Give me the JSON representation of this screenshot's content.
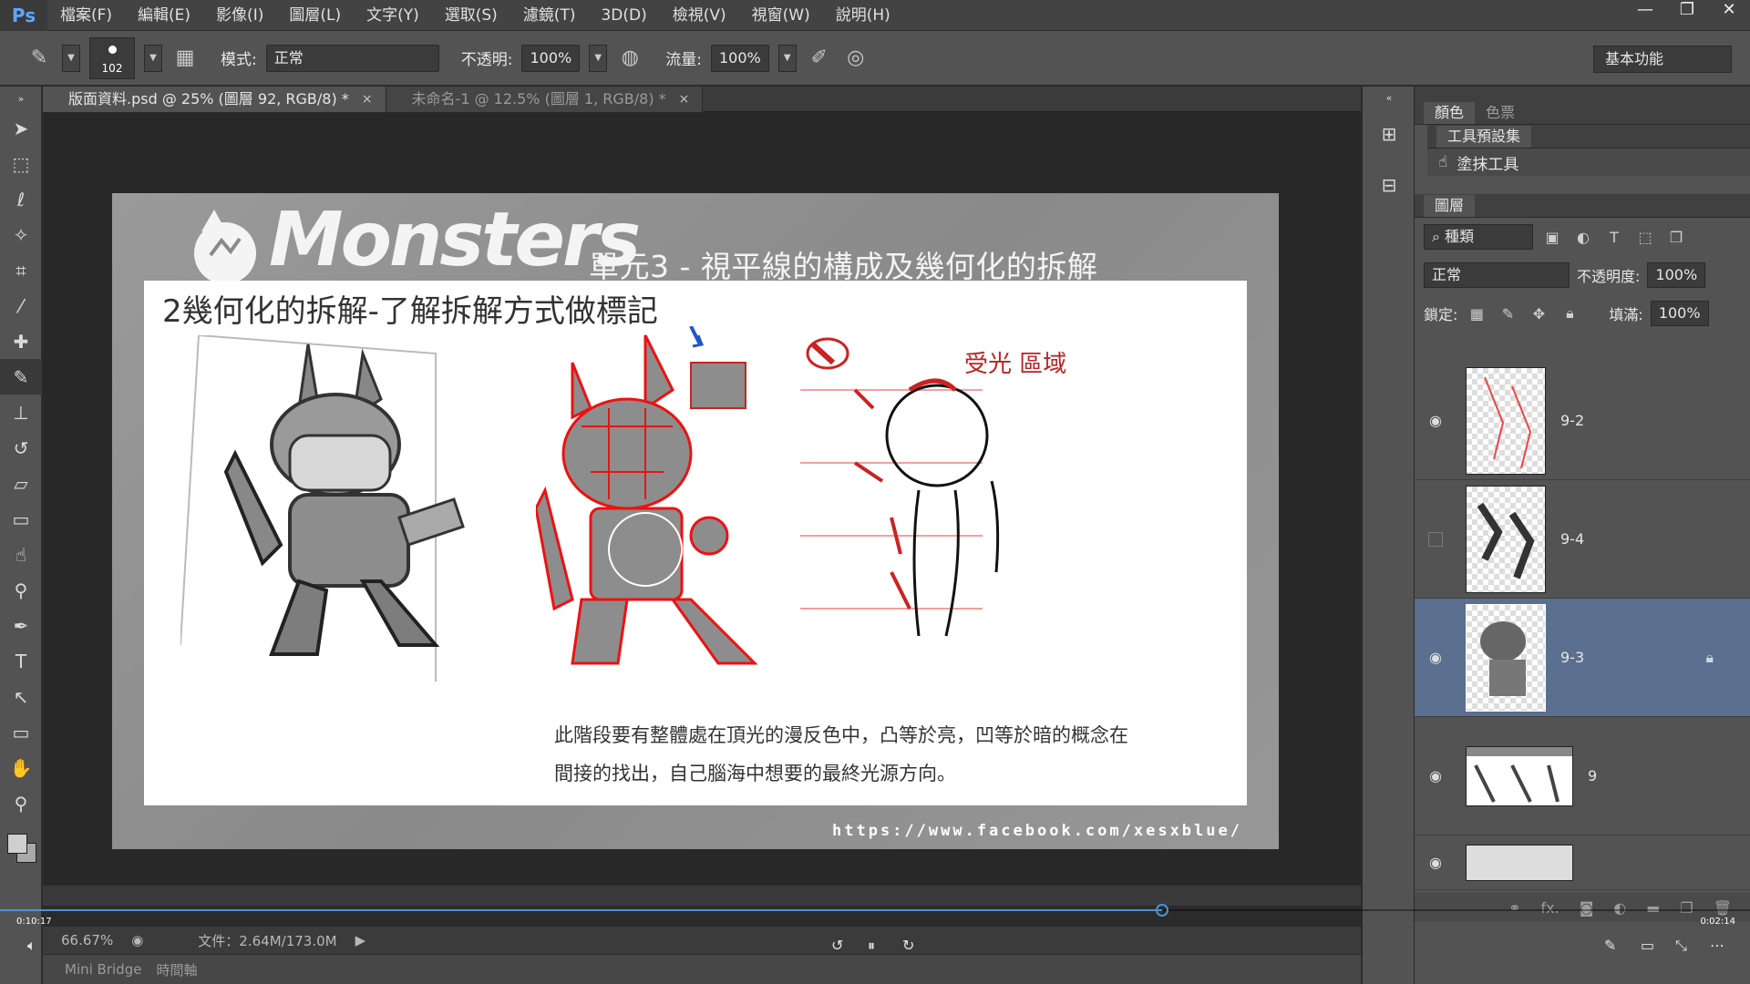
{
  "app": {
    "logo": "Ps"
  },
  "menu": [
    "檔案(F)",
    "編輯(E)",
    "影像(I)",
    "圖層(L)",
    "文字(Y)",
    "選取(S)",
    "濾鏡(T)",
    "3D(D)",
    "檢視(V)",
    "視窗(W)",
    "說明(H)"
  ],
  "window_controls": {
    "minimize": "—",
    "maximize": "❐",
    "close": "✕"
  },
  "options": {
    "brush_size": "102",
    "mode_label": "模式:",
    "mode_value": "正常",
    "opacity_label": "不透明:",
    "opacity_value": "100%",
    "flow_label": "流量:",
    "flow_value": "100%",
    "workspace": "基本功能"
  },
  "tabs": [
    {
      "label": "版面資料.psd @ 25% (圖層 92, RGB/8) *",
      "close": "×"
    },
    {
      "label": "未命名-1 @ 12.5% (圖層 1, RGB/8) *",
      "close": "×"
    }
  ],
  "artwork": {
    "logo_text": "Monsters",
    "unit_title": "單元3 - 視平線的構成及幾何化的拆解",
    "subtitle": "2幾何化的拆解-了解拆解方式做標記",
    "description_line1": "此階段要有整體處在頂光的漫反色中，凸等於亮，凹等於暗的概念在",
    "description_line2": "間接的找出，自己腦海中想要的最終光源方向。",
    "url": "https://www.facebook.com/xesxblue/",
    "annotation": "受光 區域"
  },
  "panels": {
    "top_tabs": [
      "顏色",
      "色票"
    ],
    "presets_tab": "工具預設集",
    "preset_item": "塗抹工具",
    "layers_tab": "圖層",
    "filter_kind": "種類",
    "blend_mode": "正常",
    "opacity_label": "不透明度:",
    "opacity_value": "100%",
    "lock_label": "鎖定:",
    "fill_label": "填滿:",
    "fill_value": "100%",
    "layers": [
      {
        "name": "9-2",
        "visible": true,
        "selected": false,
        "locked": false
      },
      {
        "name": "9-4",
        "visible": false,
        "selected": false,
        "locked": false
      },
      {
        "name": "9-3",
        "visible": true,
        "selected": true,
        "locked": true
      },
      {
        "name": "9",
        "visible": true,
        "selected": false,
        "locked": false
      }
    ],
    "footer_fx": "fx."
  },
  "status": {
    "zoom": "66.67%",
    "doc_size": "文件：2.64M/173.0M"
  },
  "bridge": {
    "tab1": "Mini Bridge",
    "tab2": "時間軸"
  },
  "video": {
    "time_current": "0:10:17",
    "time_total": "0:02:14",
    "progress": 0.664
  },
  "colors": {
    "selected_layer": "#5b6f8e",
    "progress": "#4b93d8",
    "ps_blue": "#5ea8ff"
  }
}
